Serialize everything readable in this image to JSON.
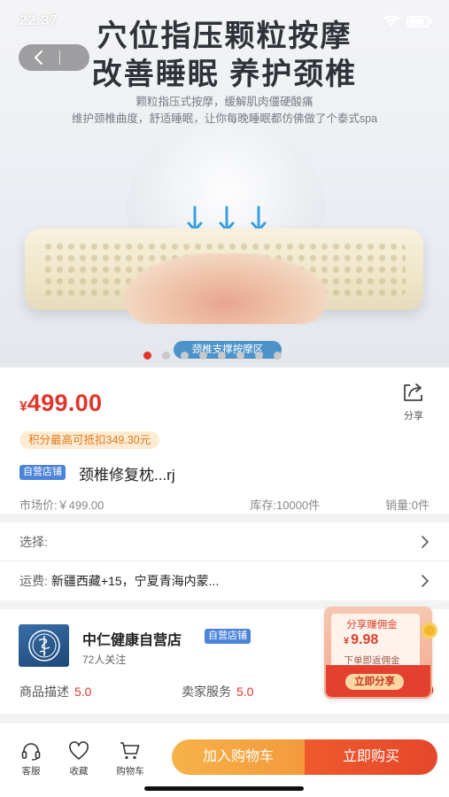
{
  "status": {
    "time": "22:37"
  },
  "hero": {
    "title_line1": "穴位指压颗粒按摩",
    "title_line2": "改善睡眠 养护颈椎",
    "sub_line1": "颗粒指压式按摩，缓解肌肉僵硬酸痛",
    "sub_line2": "维护颈椎曲度，舒适睡眠，让你每晚睡眠都仿佛做了个泰式spa",
    "zone_label": "颈椎支撑按摩区",
    "slide_count": 8,
    "active_slide": 1
  },
  "product": {
    "currency": "¥",
    "price": "499.00",
    "share_label": "分享",
    "points_tag": "积分最高可抵扣349.30元",
    "self_tag": "自营店铺",
    "name": "颈椎修复枕...rj",
    "market_price": "市场价:￥499.00",
    "stock": "库存:10000件",
    "sales": "销量:0件"
  },
  "options": {
    "select_label": "选择:",
    "shipping_label": "运费:",
    "shipping_value": "新疆西藏+15，宁夏青海内蒙..."
  },
  "shop": {
    "name": "中仁健康自营店",
    "tag": "自营店铺",
    "followers": "72人关注",
    "desc_label": "商品描述",
    "desc_score": "5.0",
    "seller_label": "卖家服务",
    "seller_score": "5.0",
    "third_score": "0"
  },
  "commission": {
    "title": "分享赚佣金",
    "currency": "¥",
    "amount": "9.98",
    "note": "下单即返佣金",
    "button": "立即分享"
  },
  "bottom": {
    "service": "客服",
    "favorite": "收藏",
    "cart": "购物车",
    "add_cart": "加入购物车",
    "buy_now": "立即购买"
  },
  "colors": {
    "price_red": "#e0352b",
    "cart_orange": "#f39a3c",
    "buy_red": "#e5472a",
    "shop_tag_blue": "#4d84d9"
  }
}
